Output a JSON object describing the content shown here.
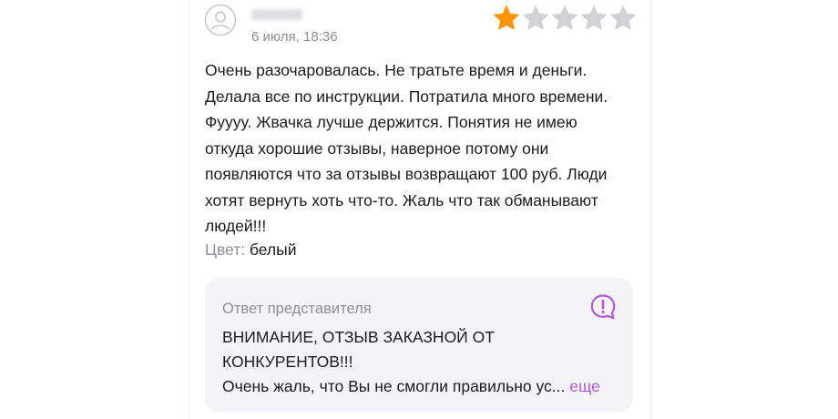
{
  "review": {
    "date": "6 июля, 18:36",
    "rating": 1,
    "max_rating": 5,
    "star_color": "#ff9500",
    "star_empty_color": "#d1d1d6",
    "text_lines": [
      "Очень разочаровалась. Не тратьте время и деньги.",
      "Делала все по инструкции. Потратила много времени.",
      "Фуууу. Жвачка лучше держится. Понятия не имею",
      "откуда хорошие отзывы, наверное потому они",
      "появляются что за отзывы возвращают 100 руб. Люди",
      "хотят вернуть хоть что-то. Жаль что так обманывают",
      "людей!!!"
    ],
    "color_label": "Цвет:",
    "color_value": "белый"
  },
  "answer": {
    "title": "Ответ представителя",
    "lines": [
      "ВНИМАНИЕ, ОТЗЫВ ЗАКАЗНОЙ ОТ",
      "КОНКУРЕНТОВ!!!",
      "Очень жаль, что Вы не смогли правильно ус..."
    ],
    "more_label": "еще",
    "accent": "#b05ad6",
    "icon": "question-chat-icon"
  }
}
